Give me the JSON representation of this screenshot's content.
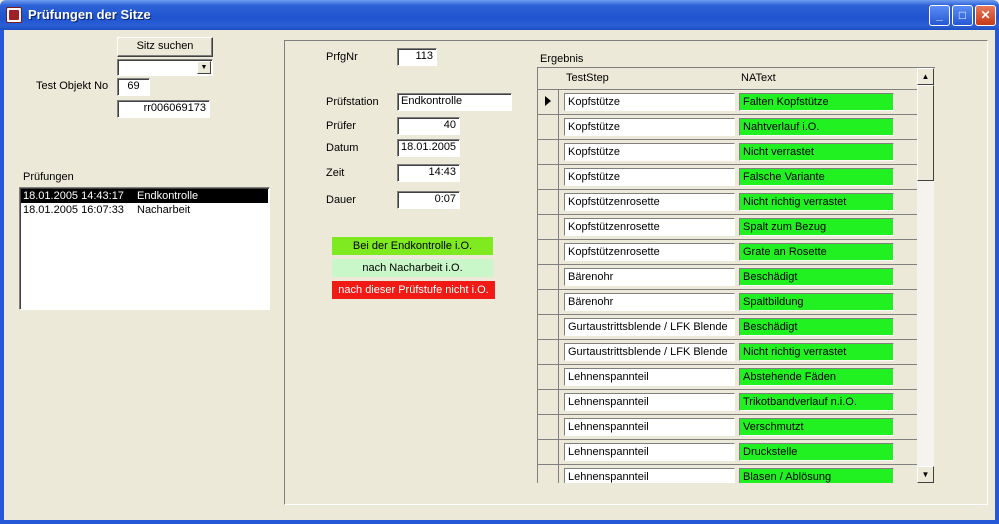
{
  "window": {
    "title": "Prüfungen der Sitze",
    "minimize_label": "_",
    "maximize_label": "□",
    "close_label": "✕"
  },
  "left": {
    "search_button": "Sitz suchen",
    "dropdown_value": "",
    "dropdown_arrow": "▼",
    "test_object_label": "Test Objekt No",
    "test_object_no": "69",
    "object_id": "rr006069173",
    "pruefungen_label": "Prüfungen",
    "pruefungen": [
      {
        "datetime": "18.01.2005 14:43:17",
        "station": "Endkontrolle",
        "selected": true
      },
      {
        "datetime": "18.01.2005 16:07:33",
        "station": "Nacharbeit",
        "selected": false
      }
    ]
  },
  "detail": {
    "prfgnr_label": "PrfgNr",
    "prfgnr": "113",
    "station_label": "Prüfstation",
    "station": "Endkontrolle",
    "pruefer_label": "Prüfer",
    "pruefer": "40",
    "datum_label": "Datum",
    "datum": "18.01.2005",
    "zeit_label": "Zeit",
    "zeit": "14:43",
    "dauer_label": "Dauer",
    "dauer": "0:07"
  },
  "legend": [
    {
      "text": "Bei der Endkontrolle i.O.",
      "color": "#7fea1f",
      "text_color": "#000000"
    },
    {
      "text": "nach Nacharbeit i.O.",
      "color": "#c9f7c9",
      "text_color": "#000000"
    },
    {
      "text": "nach dieser Prüfstufe nicht i.O.",
      "color": "#f21a14",
      "text_color": "#ffffff"
    }
  ],
  "ergebnis": {
    "label": "Ergebnis",
    "col_step": "TestStep",
    "col_na": "NAText",
    "na_color": "#21f021",
    "rows": [
      {
        "step": "Kopfstütze",
        "na": "Falten Kopfstütze",
        "current": true
      },
      {
        "step": "Kopfstütze",
        "na": "Nahtverlauf i.O.",
        "current": false
      },
      {
        "step": "Kopfstütze",
        "na": "Nicht verrastet",
        "current": false
      },
      {
        "step": "Kopfstütze",
        "na": "Falsche Variante",
        "current": false
      },
      {
        "step": "Kopfstützenrosette",
        "na": "Nicht richtig verrastet",
        "current": false
      },
      {
        "step": "Kopfstützenrosette",
        "na": "Spalt zum Bezug",
        "current": false
      },
      {
        "step": "Kopfstützenrosette",
        "na": "Grate an Rosette",
        "current": false
      },
      {
        "step": "Bärenohr",
        "na": "Beschädigt",
        "current": false
      },
      {
        "step": "Bärenohr",
        "na": "Spaltbildung",
        "current": false
      },
      {
        "step": "Gurtaustrittsblende / LFK Blende",
        "na": "Beschädigt",
        "current": false
      },
      {
        "step": "Gurtaustrittsblende / LFK Blende",
        "na": "Nicht richtig verrastet",
        "current": false
      },
      {
        "step": "Lehnenspannteil",
        "na": "Abstehende Fäden",
        "current": false
      },
      {
        "step": "Lehnenspannteil",
        "na": "Trikotbandverlauf n.i.O.",
        "current": false
      },
      {
        "step": "Lehnenspannteil",
        "na": "Verschmutzt",
        "current": false
      },
      {
        "step": "Lehnenspannteil",
        "na": "Druckstelle",
        "current": false
      },
      {
        "step": "Lehnenspannteil",
        "na": "Blasen / Ablösung",
        "current": false
      }
    ],
    "scroll_up": "▲",
    "scroll_down": "▼"
  }
}
